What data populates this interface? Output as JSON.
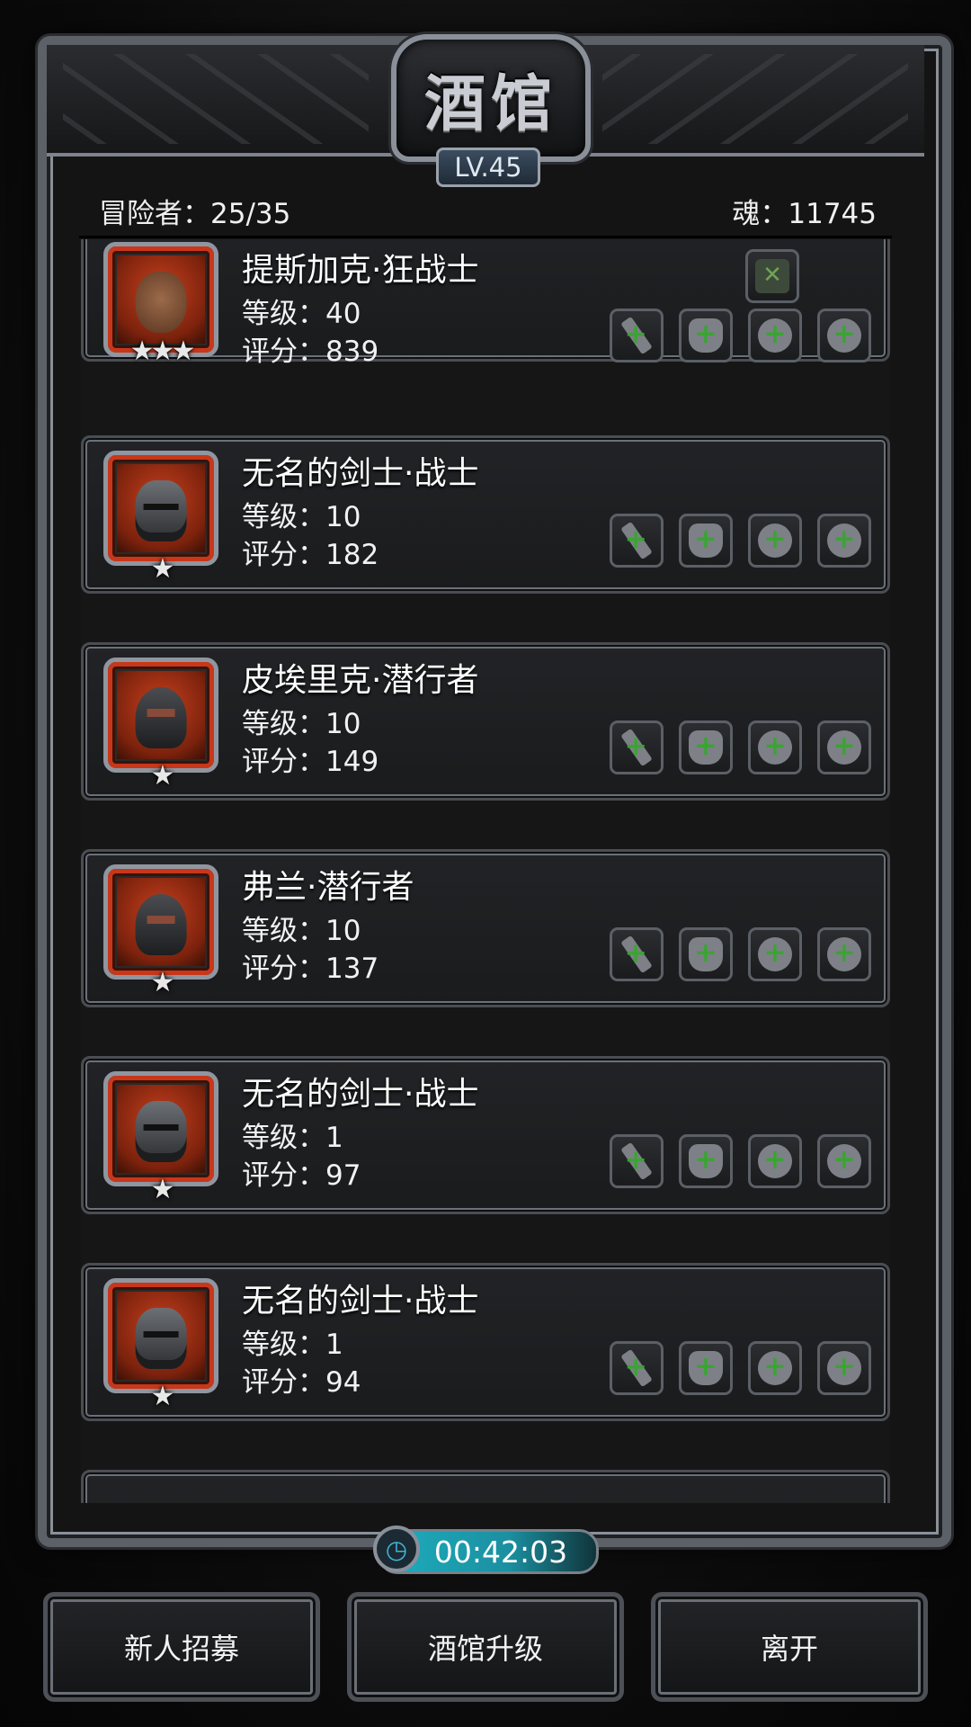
{
  "header": {
    "title": "酒馆",
    "level": "LV.45",
    "adventurers": "冒险者：25/35",
    "soul": "魂：11745"
  },
  "heroes": [
    {
      "name": "提斯加克·狂战士",
      "level": "等级：40",
      "score": "评分：839",
      "stars": "★★★",
      "portrait": "brute-icon",
      "has_skill_slot": true
    },
    {
      "name": "无名的剑士·战士",
      "level": "等级：10",
      "score": "评分：182",
      "stars": "★",
      "portrait": "helm-icon"
    },
    {
      "name": "皮埃里克·潜行者",
      "level": "等级：10",
      "score": "评分：149",
      "stars": "★",
      "portrait": "hood-icon"
    },
    {
      "name": "弗兰·潜行者",
      "level": "等级：10",
      "score": "评分：137",
      "stars": "★",
      "portrait": "hood-icon"
    },
    {
      "name": "无名的剑士·战士",
      "level": "等级：1",
      "score": "评分：97",
      "stars": "★",
      "portrait": "helm-icon"
    },
    {
      "name": "无名的剑士·战士",
      "level": "等级：1",
      "score": "评分：94",
      "stars": "★",
      "portrait": "helm-icon"
    }
  ],
  "equipment_slots": [
    "weapon-icon",
    "armor-icon",
    "ring-icon",
    "ring-icon"
  ],
  "timer": "00:42:03",
  "buttons": {
    "recruit": "新人招募",
    "upgrade": "酒馆升级",
    "leave": "离开"
  },
  "colors": {
    "portrait_border": "#c8371a",
    "timer_fill": "#1eaebf",
    "slot_plus": "#3aa432"
  }
}
